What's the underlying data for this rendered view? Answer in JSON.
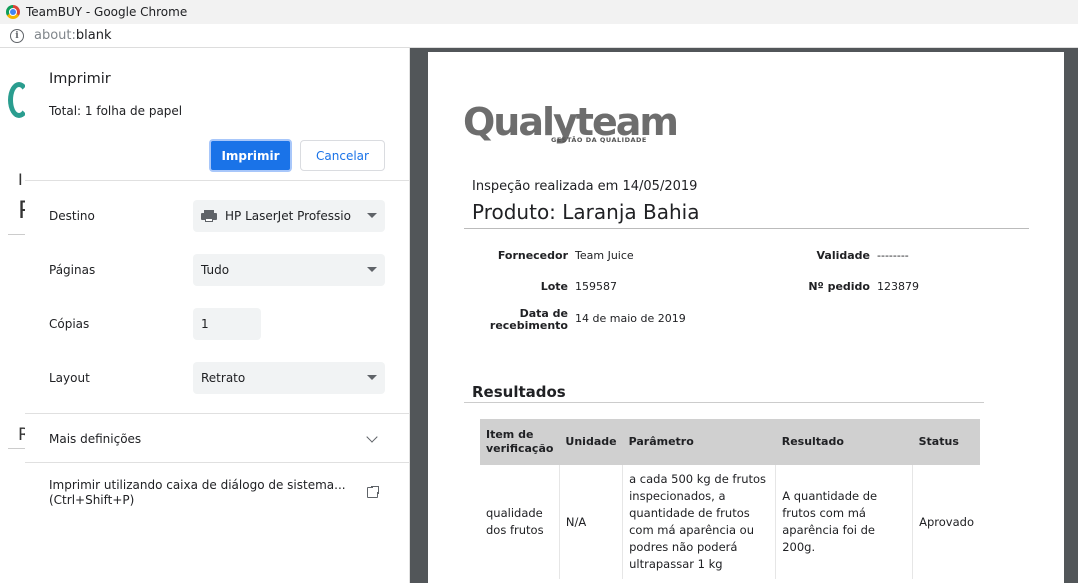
{
  "window": {
    "title": "TeamBUY - Google Chrome"
  },
  "address": {
    "scheme": "about:",
    "rest": "blank"
  },
  "background_page": {
    "frag1": "I",
    "frag2": "P",
    "frag3": "R"
  },
  "dialog": {
    "title": "Imprimir",
    "total_prefix": "Total: ",
    "total_value": "1 folha de papel",
    "print_label": "Imprimir",
    "cancel_label": "Cancelar",
    "destination": {
      "label": "Destino",
      "value": "HP LaserJet Professio"
    },
    "pages": {
      "label": "Páginas",
      "value": "Tudo"
    },
    "copies": {
      "label": "Cópias",
      "value": "1"
    },
    "layout": {
      "label": "Layout",
      "value": "Retrato"
    },
    "more_settings": "Mais definições",
    "system_dialog_line1": "Imprimir utilizando caixa de diálogo de sistema...",
    "system_dialog_line2": "(Ctrl+Shift+P)"
  },
  "document": {
    "logo_text": "Qualyteam",
    "logo_sub": "GESTÃO DA QUALIDADE",
    "inspection": "Inspeção realizada em 14/05/2019",
    "product": "Produto: Laranja Bahia",
    "fields": {
      "fornecedor_label": "Fornecedor",
      "fornecedor_value": "Team Juice",
      "validade_label": "Validade",
      "validade_value": "--------",
      "lote_label": "Lote",
      "lote_value": "159587",
      "pedido_label": "Nº pedido",
      "pedido_value": "123879",
      "data_label_1": "Data de",
      "data_label_2": "recebimento",
      "data_value": "14 de maio de 2019"
    },
    "results_title": "Resultados",
    "table": {
      "headers": [
        "Item de verificação",
        "Unidade",
        "Parâmetro",
        "Resultado",
        "Status"
      ],
      "rows": [
        {
          "item": "qualidade dos frutos",
          "unidade": "N/A",
          "parametro": "a cada 500 kg de frutos inspecionados, a quantidade de frutos com má aparência ou podres não poderá ultrapassar 1 kg",
          "resultado": "A quantidade de frutos com má aparência foi de 200g.",
          "status": "Aprovado"
        }
      ]
    }
  },
  "colors": {
    "primary": "#1a73e8",
    "preview_bg": "#525659",
    "table_header": "#d0d0d0"
  }
}
